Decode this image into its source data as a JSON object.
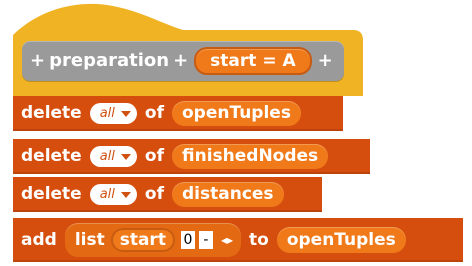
{
  "hat_block": {
    "plus_left": "+",
    "title": "preparation",
    "plus_mid": "+",
    "param": "start = A",
    "plus_right": "+"
  },
  "commands": [
    {
      "keyword": "delete",
      "option": "all",
      "of_label": "of",
      "target": "openTuples"
    },
    {
      "keyword": "delete",
      "option": "all",
      "of_label": "of",
      "target": "finishedNodes"
    },
    {
      "keyword": "delete",
      "option": "all",
      "of_label": "of",
      "target": "distances"
    }
  ],
  "add_block": {
    "keyword": "add",
    "list_label": "list",
    "item": "start",
    "extra_value": "0",
    "extra_dash": "-",
    "arrows": "◂▸",
    "to_label": "to",
    "target": "openTuples"
  },
  "colors": {
    "hat_yellow": "#f0b323",
    "hat_panel": "#9a9a9a",
    "command_bg": "#d64e0e",
    "pill_bg": "#f07a1a"
  }
}
